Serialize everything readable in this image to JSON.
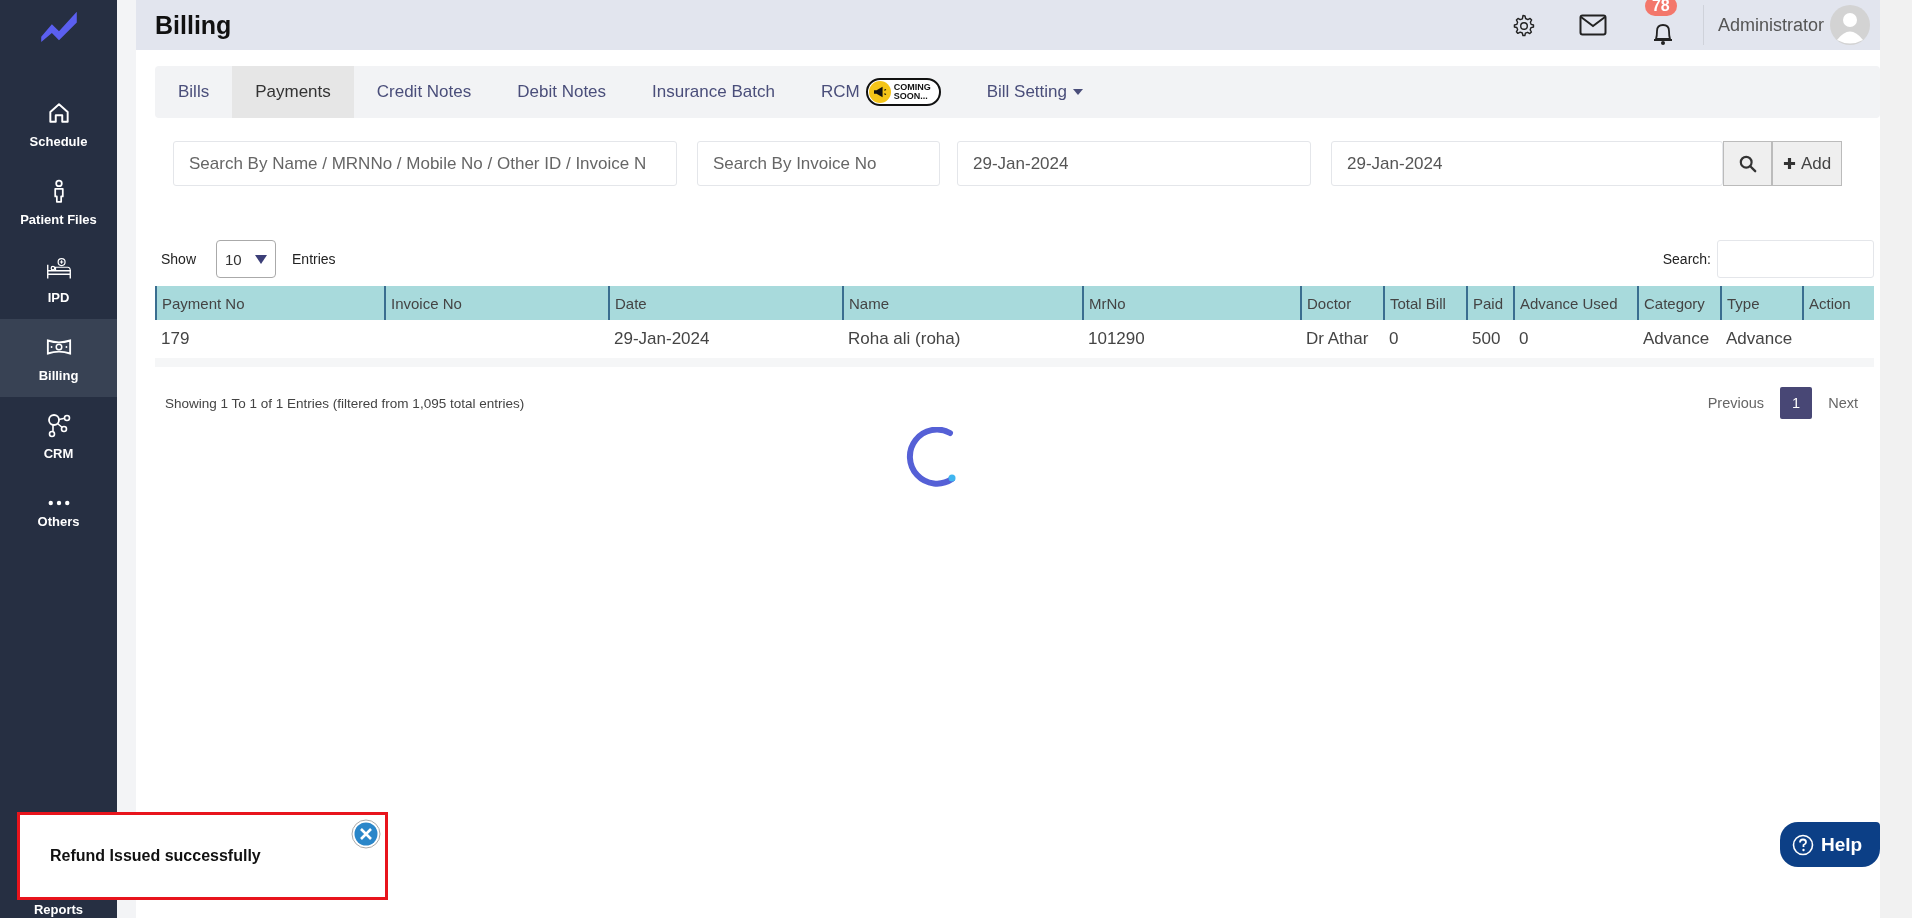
{
  "sidebar": {
    "items": [
      {
        "label": "Schedule",
        "selected": false
      },
      {
        "label": "Patient Files",
        "selected": false
      },
      {
        "label": "IPD",
        "selected": false
      },
      {
        "label": "Billing",
        "selected": true
      },
      {
        "label": "CRM",
        "selected": false
      },
      {
        "label": "Others",
        "selected": false
      },
      {
        "label": "Reports",
        "selected": false
      }
    ]
  },
  "header": {
    "title": "Billing",
    "notification_count": "78",
    "user": "Administrator"
  },
  "tabs": [
    {
      "label": "Bills",
      "kind": "plain",
      "selected": false
    },
    {
      "label": "Payments",
      "kind": "plain",
      "selected": true
    },
    {
      "label": "Credit Notes",
      "kind": "plain",
      "selected": false
    },
    {
      "label": "Debit Notes",
      "kind": "plain",
      "selected": false
    },
    {
      "label": "Insurance Batch",
      "kind": "plain",
      "selected": false
    },
    {
      "label": "RCM",
      "kind": "badge",
      "badge": [
        "COMING",
        "SOON..."
      ],
      "selected": false
    },
    {
      "label": "Bill Setting",
      "kind": "dropdown",
      "selected": false
    }
  ],
  "filters": [
    {
      "placeholder": "Search By Name / MRNNo / Mobile No / Other ID / Invoice N"
    },
    {
      "placeholder": "Search By Invoice No"
    },
    {
      "value": "29-Jan-2024"
    },
    {
      "value": "29-Jan-2024"
    }
  ],
  "add_button": "Add",
  "length_menu": {
    "label": "Show",
    "value": "10",
    "suffix": "Entries"
  },
  "search_label": "Search:",
  "table": {
    "columns": [
      "Payment No",
      "Invoice No",
      "Date",
      "Name",
      "MrNo",
      "Doctor",
      "Total Bill",
      "Paid",
      "Advance Used",
      "Category",
      "Type",
      "Action"
    ],
    "rows": [
      [
        "179",
        "",
        "29-Jan-2024",
        "Roha ali (roha)",
        "101290",
        "Dr Athar",
        "0",
        "500",
        "0",
        "Advance",
        "Advance",
        ""
      ]
    ]
  },
  "info": "Showing 1 To 1 of 1 Entries (filtered from 1,095 total entries)",
  "pagination": [
    {
      "label": "Previous",
      "selected": false
    },
    {
      "label": "1",
      "selected": true
    },
    {
      "label": "Next",
      "selected": false
    }
  ],
  "toast": {
    "message": "Refund Issued successfully"
  },
  "help": {
    "label": "Help"
  }
}
